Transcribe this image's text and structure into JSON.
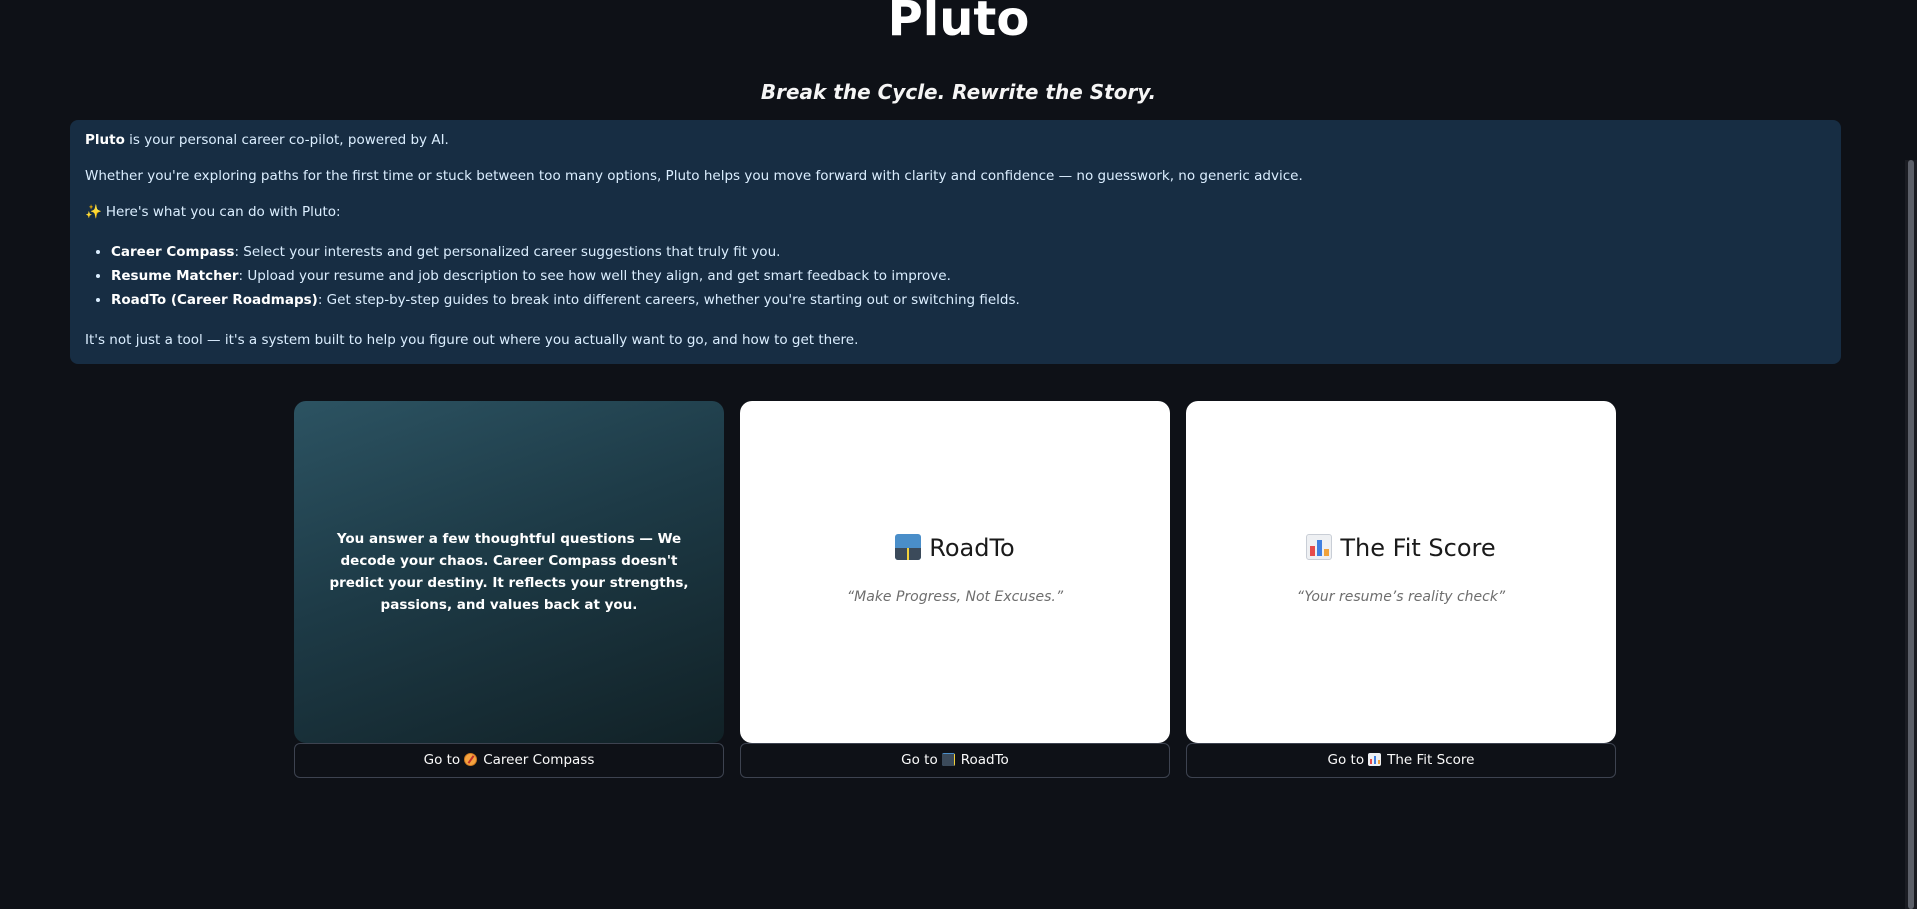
{
  "header": {
    "title": "Pluto",
    "tagline": "Break the Cycle. Rewrite the Story."
  },
  "info": {
    "intro_bold": "Pluto",
    "intro_rest": " is your personal career co-pilot, powered by AI.",
    "para2": "Whether you're exploring paths for the first time or stuck between too many options, Pluto helps you move forward with clarity and confidence — no guesswork, no generic advice.",
    "sparkle": "✨",
    "features_heading": "Here's what you can do with Pluto:",
    "features": [
      {
        "name": "Career Compass",
        "desc": ": Select your interests and get personalized career suggestions that truly fit you."
      },
      {
        "name": "Resume Matcher",
        "desc": ": Upload your resume and job description to see how well they align, and get smart feedback to improve."
      },
      {
        "name": "RoadTo (Career Roadmaps)",
        "desc": ": Get step-by-step guides to break into different careers, whether you're starting out or switching fields."
      }
    ],
    "closing": "It's not just a tool — it's a system built to help you figure out where you actually want to go, and how to get there."
  },
  "cards": {
    "compass": {
      "text": "You answer a few thoughtful questions — We decode your chaos. Career Compass doesn't predict your destiny. It reflects your strengths, passions, and values back at you."
    },
    "roadto": {
      "icon": "motorway-icon",
      "title": "RoadTo",
      "quote": "“Make Progress, Not Excuses.”"
    },
    "fitscore": {
      "icon": "bar-chart-icon",
      "title": "The Fit Score",
      "quote": "“Your resume’s reality check”"
    }
  },
  "buttons": {
    "go_to": "Go to",
    "compass_label": "Career Compass",
    "compass_icon": "compass-icon",
    "roadto_label": "RoadTo",
    "roadto_icon": "motorway-icon",
    "fitscore_label": "The Fit Score",
    "fitscore_icon": "bar-chart-icon"
  },
  "colors": {
    "background": "#0e1117",
    "info_box": "#172d43",
    "card_white": "#ffffff"
  }
}
